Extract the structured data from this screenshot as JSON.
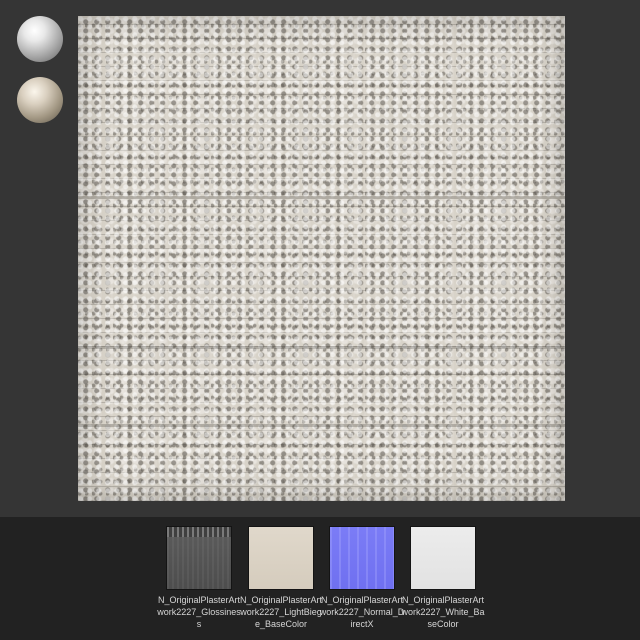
{
  "materials": [
    {
      "name": "white-material"
    },
    {
      "name": "beige-material"
    }
  ],
  "textures": [
    {
      "label": "N_OriginalPlasterArtwork2227_Glossiness"
    },
    {
      "label": "N_OriginalPlasterArtwork2227_LightBiege_BaseColor"
    },
    {
      "label": "N_OriginalPlasterArtwork2227_Normal_DirectX"
    },
    {
      "label": "N_OriginalPlasterArtwork2227_White_BaseColor"
    }
  ],
  "colors": {
    "background": "#353535",
    "panel": "#222222",
    "plaster": "#d8d3c9",
    "normal_map": "#7677f4"
  }
}
